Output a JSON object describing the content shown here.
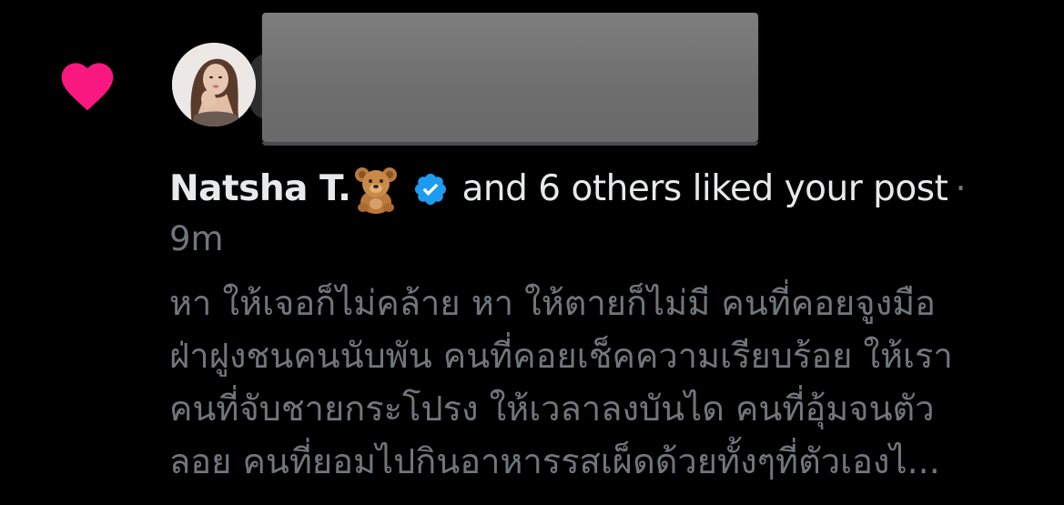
{
  "notification": {
    "type_icon": "heart-icon",
    "actor_name": "Natsha T.",
    "actor_emoji": "teddy-bear-emoji",
    "verified_icon": "verified-badge-icon",
    "action_text": "and 6 others liked your post",
    "separator": "·",
    "timestamp": "9m",
    "post_preview_lines": [
      "หา ให้เจอก็ไม่คล้าย หา ให้ตายก็ไม่มี คนที่คอยจูงมือ",
      "ฝ่าฝูงชนคนนับพัน คนที่คอยเช็คความเรียบร้อย ให้เรา",
      "คนที่จับชายกระโปรง ให้เวลาลงบันได คนที่อุ้มจนตัว",
      "ลอย คนที่ยอมไปกินอาหารรสเผ็ดด้วยทั้งๆที่ตัวเองไ..."
    ]
  },
  "colors": {
    "background": "#000000",
    "heart": "#f91880",
    "primary_text": "#e7e9ea",
    "secondary_text": "#71767b",
    "verified_blue": "#1d9bf0"
  }
}
